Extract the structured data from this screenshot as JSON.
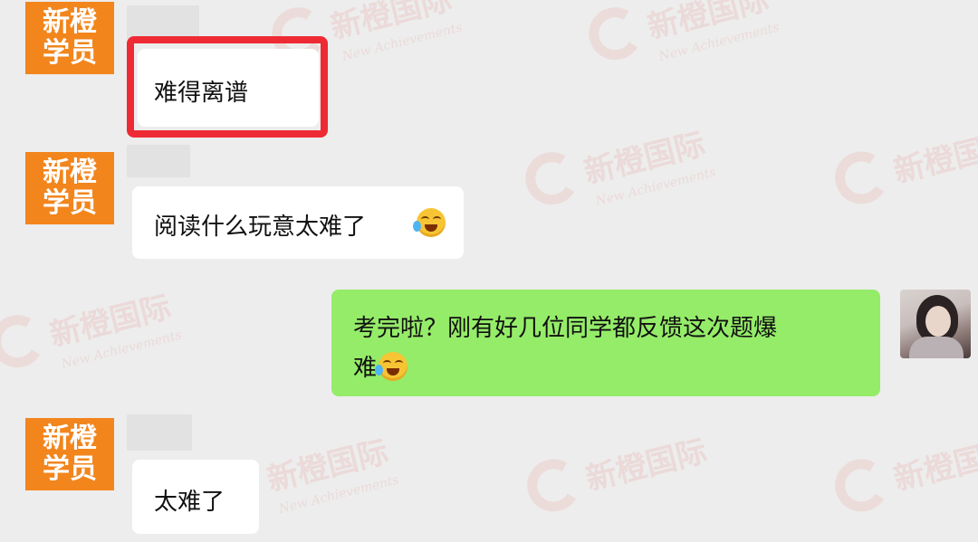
{
  "watermark": {
    "brand_cn": "新橙国际",
    "brand_en": "New Achievements"
  },
  "messages": [
    {
      "side": "left",
      "sender_badge": [
        "新橙",
        "学员"
      ],
      "text": "难得离谱",
      "highlighted": true,
      "emoji": null
    },
    {
      "side": "left",
      "sender_badge": [
        "新橙",
        "学员"
      ],
      "text": "阅读什么玩意太难了",
      "highlighted": false,
      "emoji": "crying-laughing-emoji"
    },
    {
      "side": "right",
      "text_line1": "考完啦？刚有好几位同学都反馈这次题爆",
      "text_line2": "难",
      "emoji": "crying-laughing-emoji"
    },
    {
      "side": "left",
      "sender_badge": [
        "新橙",
        "学员"
      ],
      "text": "太难了",
      "highlighted": false,
      "emoji": null
    }
  ],
  "colors": {
    "background": "#ededed",
    "badge": "#f2851c",
    "right_bubble": "#95ec69",
    "highlight_border": "#ee2b34"
  }
}
